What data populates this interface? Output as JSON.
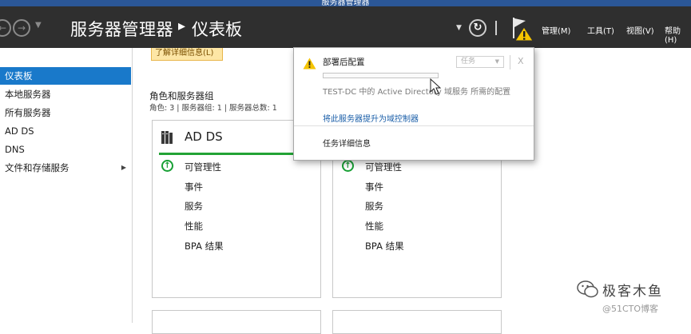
{
  "window": {
    "title": "服务器管理器"
  },
  "header": {
    "app_title": "服务器管理器",
    "separator": "▸",
    "page_title": "仪表板",
    "menu": [
      "管理(M)",
      "工具(T)",
      "视图(V)",
      "帮助(H)"
    ],
    "icons": [
      "back-icon",
      "forward-icon",
      "refresh-icon",
      "notification-flag-icon",
      "warning-icon"
    ]
  },
  "sidebar": {
    "items": [
      {
        "label": "仪表板",
        "active": true
      },
      {
        "label": "本地服务器"
      },
      {
        "label": "所有服务器"
      },
      {
        "label": "AD DS"
      },
      {
        "label": "DNS"
      },
      {
        "label": "文件和存储服务",
        "has_arrow": true
      }
    ]
  },
  "main": {
    "banner": "了解详细信息(L)",
    "roles_title": "角色和服务器组",
    "roles_subtitle": "角色: 3 | 服务器组: 1 | 服务器总数: 1"
  },
  "tiles": [
    {
      "title": "AD DS",
      "rows": [
        "可管理性",
        "事件",
        "服务",
        "性能",
        "BPA 结果"
      ]
    },
    {
      "title": "",
      "rows": [
        "可管理性",
        "事件",
        "服务",
        "性能",
        "BPA 结果"
      ]
    }
  ],
  "popup": {
    "title": "部署后配置",
    "tasks_label": "任务",
    "close_label": "X",
    "progress": 0,
    "description": "TEST-DC 中的 Active Directory 域服务 所需的配置",
    "link": "将此服务器提升为域控制器",
    "details": "任务详细信息"
  },
  "watermark": {
    "name": "极客木鱼",
    "site": "@51CTO博客"
  },
  "colors": {
    "header_bg": "#2f2f2f",
    "selected_bg": "#1979ca",
    "healthy_green": "#22a335",
    "warning_yellow": "#f5c400",
    "link_blue": "#1a5ea8"
  }
}
